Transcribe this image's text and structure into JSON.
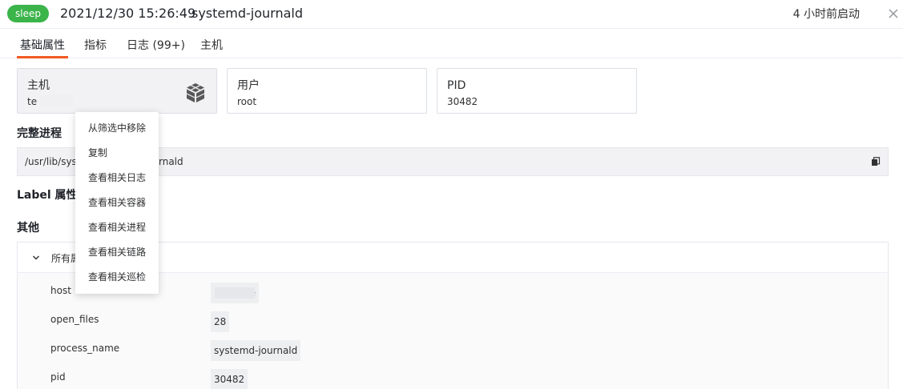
{
  "header": {
    "status": "sleep",
    "datetime": "2021/12/30 15:26:49",
    "process": "systemd-journald",
    "started": "4 小时前启动",
    "close_icon": "close-icon"
  },
  "tabs": [
    {
      "label": "基础属性",
      "active": true
    },
    {
      "label": "指标",
      "active": false
    },
    {
      "label": "日志 (99+)",
      "active": false
    },
    {
      "label": "主机",
      "active": false
    }
  ],
  "cards": {
    "host": {
      "label": "主机",
      "value": "te",
      "icon": "cube-icon"
    },
    "user": {
      "label": "用户",
      "value": "root"
    },
    "pid": {
      "label": "PID",
      "value": "30482"
    }
  },
  "full_process": {
    "title": "完整进程",
    "value_start": "/usr/lib/syst",
    "value_end": "rnald",
    "copy_icon": "copy-icon"
  },
  "label_section": {
    "title": "Label 属性"
  },
  "other": {
    "title": "其他",
    "group_title": "所有属",
    "rows": [
      {
        "key": "host",
        "value": "e"
      },
      {
        "key": "open_files",
        "value": "28"
      },
      {
        "key": "process_name",
        "value": "systemd-journald"
      },
      {
        "key": "pid",
        "value": "30482"
      }
    ]
  },
  "context_menu": {
    "items": [
      "从筛选中移除",
      "复制",
      "查看相关日志",
      "查看相关容器",
      "查看相关进程",
      "查看相关链路",
      "查看相关巡检"
    ]
  },
  "colors": {
    "status_green": "#3bb44a",
    "tab_accent": "#f05a22"
  }
}
